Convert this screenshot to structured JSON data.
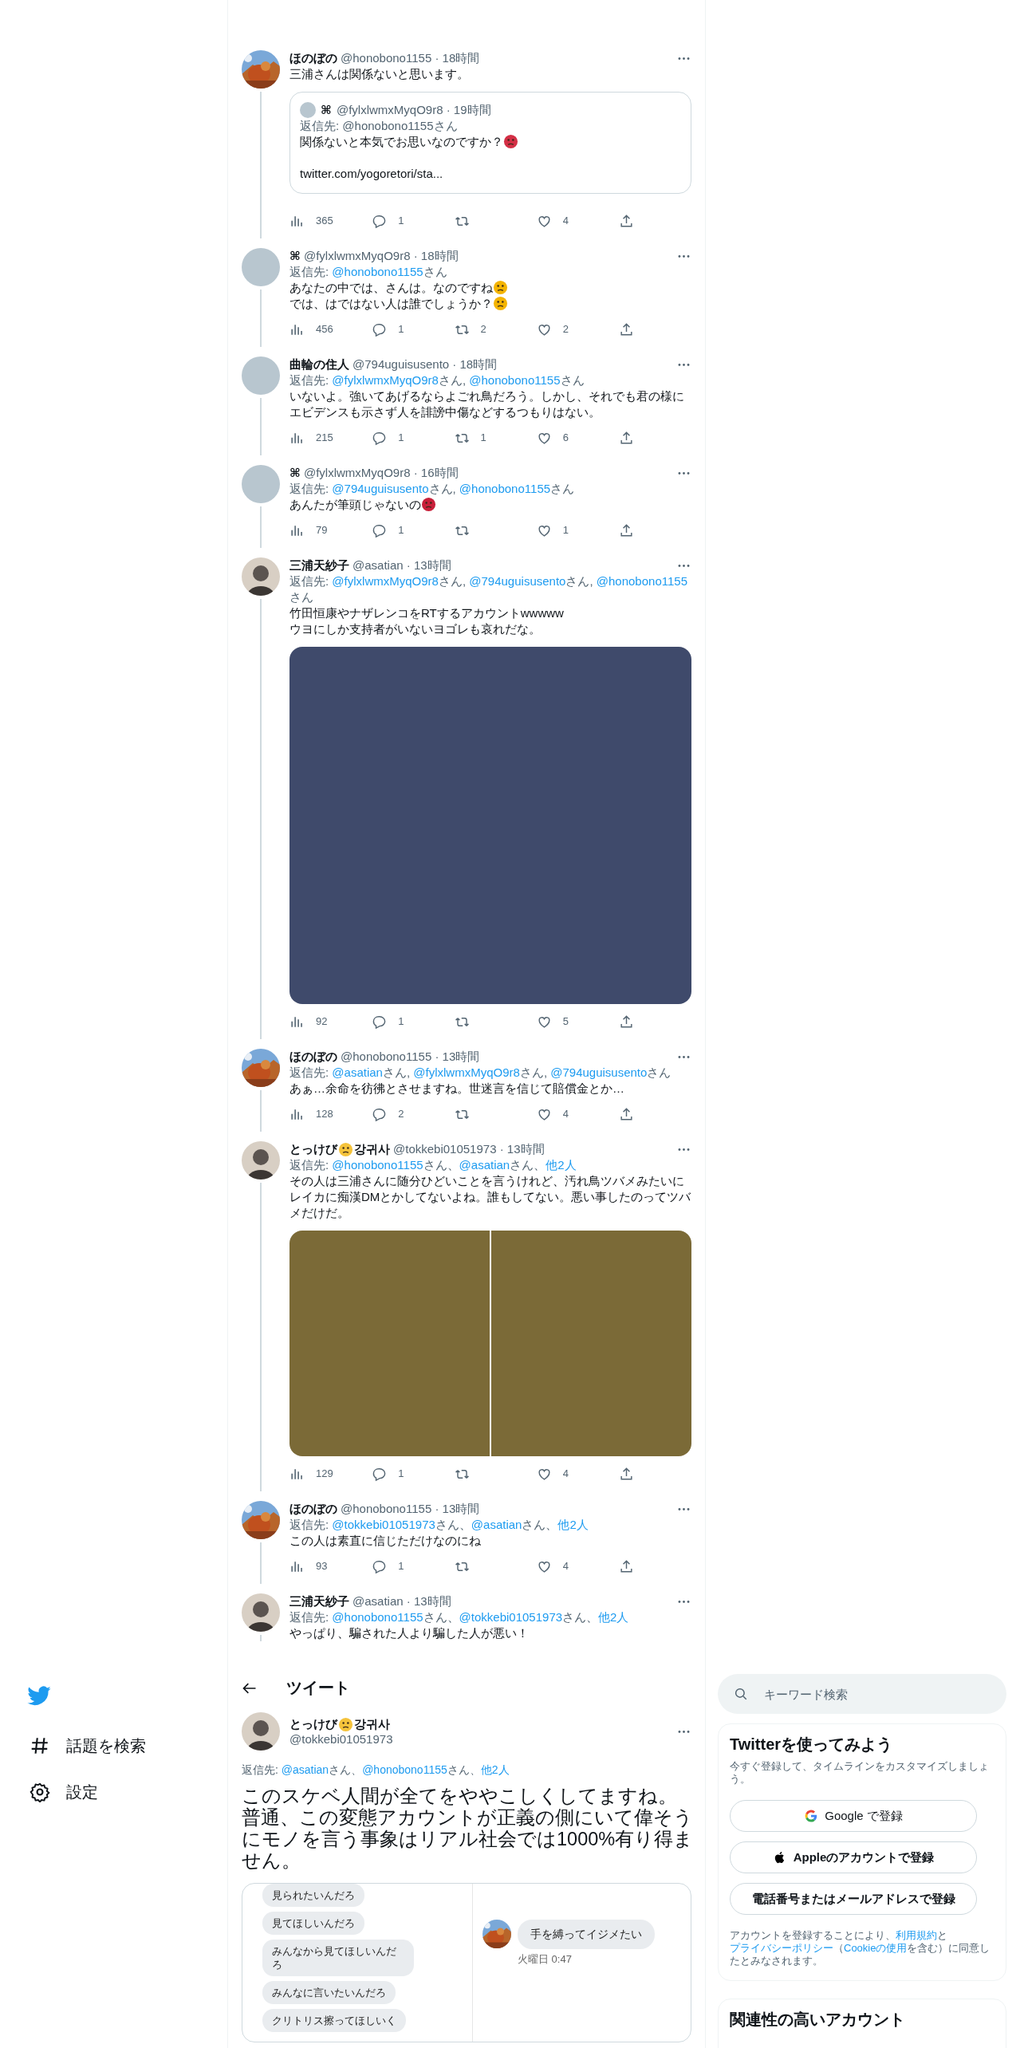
{
  "thread": [
    {
      "avatar": {
        "kind": "picture"
      },
      "name": [
        {
          "kind": "text",
          "text": "ほのぼの"
        }
      ],
      "meta": "@honobono1155 · 18時間",
      "body": [
        [
          {
            "kind": "text",
            "text": "三浦さんは関係ないと思います。"
          }
        ]
      ],
      "quote": {
        "name": "⌘",
        "meta": "@fylxlwmxMyqO9r8 · 19時間",
        "reply_to": [
          {
            "kind": "plain",
            "text": "返信先: @honobono1155さん"
          }
        ],
        "body": [
          [
            {
              "kind": "text",
              "text": "関係ないと本気でお思いなのですか？"
            },
            {
              "kind": "emoji",
              "color": "#d32f45"
            }
          ]
        ],
        "link": "twitter.com/yogoretori/sta..."
      },
      "stats": {
        "views": "365",
        "replies": "1",
        "likes": "4"
      }
    },
    {
      "avatar": {
        "kind": "blank"
      },
      "name": [
        {
          "kind": "text",
          "text": "⌘"
        }
      ],
      "meta": "@fylxlwmxMyqO9r8 · 18時間",
      "reply_to": [
        {
          "kind": "plain",
          "text": "返信先: "
        },
        {
          "kind": "mention",
          "text": "@honobono1155"
        },
        {
          "kind": "plain",
          "text": "さん"
        }
      ],
      "body": [
        [
          {
            "kind": "text",
            "text": "あなたの中では、さんは。なのですね"
          },
          {
            "kind": "emoji",
            "color": "#f4b400"
          }
        ],
        [
          {
            "kind": "text",
            "text": "では、はではない人は誰でしょうか？"
          },
          {
            "kind": "emoji",
            "color": "#f4b400"
          }
        ]
      ],
      "stats": {
        "views": "456",
        "replies": "1",
        "retweets": "2",
        "likes": "2"
      }
    },
    {
      "avatar": {
        "kind": "blank"
      },
      "name": [
        {
          "kind": "text",
          "text": "曲輪の住人"
        }
      ],
      "meta": "@794uguisusento · 18時間",
      "reply_to": [
        {
          "kind": "plain",
          "text": "返信先: "
        },
        {
          "kind": "mention",
          "text": "@fylxlwmxMyqO9r8"
        },
        {
          "kind": "plain",
          "text": "さん, "
        },
        {
          "kind": "mention",
          "text": "@honobono1155"
        },
        {
          "kind": "plain",
          "text": "さん"
        }
      ],
      "body": [
        [
          {
            "kind": "text",
            "text": "いないよ。強いてあげるならよごれ鳥だろう。しかし、それでも君の様にエビデンスも示さず人を誹謗中傷などするつもりはない。"
          }
        ]
      ],
      "stats": {
        "views": "215",
        "replies": "1",
        "retweets": "1",
        "likes": "6"
      }
    },
    {
      "avatar": {
        "kind": "blank"
      },
      "name": [
        {
          "kind": "text",
          "text": "⌘"
        }
      ],
      "meta": "@fylxlwmxMyqO9r8 · 16時間",
      "reply_to": [
        {
          "kind": "plain",
          "text": "返信先: "
        },
        {
          "kind": "mention",
          "text": "@794uguisusento"
        },
        {
          "kind": "plain",
          "text": "さん, "
        },
        {
          "kind": "mention",
          "text": "@honobono1155"
        },
        {
          "kind": "plain",
          "text": "さん"
        }
      ],
      "body": [
        [
          {
            "kind": "text",
            "text": "あんたが筆頭じゃないの"
          },
          {
            "kind": "emoji",
            "color": "#c8203a"
          }
        ]
      ],
      "stats": {
        "views": "79",
        "replies": "1",
        "likes": "1"
      }
    },
    {
      "avatar": {
        "kind": "person"
      },
      "name": [
        {
          "kind": "text",
          "text": "三浦天紗子"
        }
      ],
      "meta": "@asatian · 13時間",
      "reply_to": [
        {
          "kind": "plain",
          "text": "返信先: "
        },
        {
          "kind": "mention",
          "text": "@fylxlwmxMyqO9r8"
        },
        {
          "kind": "plain",
          "text": "さん, "
        },
        {
          "kind": "mention",
          "text": "@794uguisusento"
        },
        {
          "kind": "plain",
          "text": "さん, "
        },
        {
          "kind": "mention",
          "text": "@honobono1155"
        },
        {
          "kind": "plain",
          "text": "さん"
        }
      ],
      "body": [
        [
          {
            "kind": "text",
            "text": "竹田恒康やナザレンコをRTするアカウントwwwww"
          }
        ],
        [
          {
            "kind": "text",
            "text": "ウヨにしか支持者がいないヨゴレも哀れだな。"
          }
        ]
      ],
      "media": [
        {
          "kind": "picture",
          "color": "#3f4a6b"
        }
      ],
      "stats": {
        "views": "92",
        "replies": "1",
        "likes": "5"
      }
    },
    {
      "avatar": {
        "kind": "picture"
      },
      "name": [
        {
          "kind": "text",
          "text": "ほのぼの"
        }
      ],
      "meta": "@honobono1155 · 13時間",
      "reply_to": [
        {
          "kind": "plain",
          "text": "返信先: "
        },
        {
          "kind": "mention",
          "text": "@asatian"
        },
        {
          "kind": "plain",
          "text": "さん, "
        },
        {
          "kind": "mention",
          "text": "@fylxlwmxMyqO9r8"
        },
        {
          "kind": "plain",
          "text": "さん, "
        },
        {
          "kind": "mention",
          "text": "@794uguisusento"
        },
        {
          "kind": "plain",
          "text": "さん"
        }
      ],
      "body": [
        [
          {
            "kind": "text",
            "text": "あぁ…余命を彷彿とさせますね。世迷言を信じて賠償金とか…"
          }
        ]
      ],
      "stats": {
        "views": "128",
        "replies": "2",
        "likes": "4"
      }
    },
    {
      "avatar": {
        "kind": "person"
      },
      "name": [
        {
          "kind": "text",
          "text": "とっけび"
        },
        {
          "kind": "emoji",
          "color": "#f5c33b"
        },
        {
          "kind": "text",
          "text": "강귀사"
        }
      ],
      "meta": "@tokkebi01051973 · 13時間",
      "reply_to": [
        {
          "kind": "plain",
          "text": "返信先: "
        },
        {
          "kind": "mention",
          "text": "@honobono1155"
        },
        {
          "kind": "plain",
          "text": "さん、"
        },
        {
          "kind": "mention",
          "text": "@asatian"
        },
        {
          "kind": "plain",
          "text": "さん、"
        },
        {
          "kind": "mention",
          "text": "他2人"
        }
      ],
      "body": [
        [
          {
            "kind": "text",
            "text": "その人は三浦さんに随分ひどいことを言うけれど、汚れ鳥ツバメみたいにレイカに痴漢DMとかしてないよね。誰もしてない。悪い事したのってツバメだけだ。"
          }
        ]
      ],
      "media": [
        {
          "kind": "picture",
          "color": "#7b6a37"
        },
        {
          "kind": "picture",
          "color": "#7b6a37"
        }
      ],
      "stats": {
        "views": "129",
        "replies": "1",
        "likes": "4"
      }
    },
    {
      "avatar": {
        "kind": "picture"
      },
      "name": [
        {
          "kind": "text",
          "text": "ほのぼの"
        }
      ],
      "meta": "@honobono1155 · 13時間",
      "reply_to": [
        {
          "kind": "plain",
          "text": "返信先: "
        },
        {
          "kind": "mention",
          "text": "@tokkebi01051973"
        },
        {
          "kind": "plain",
          "text": "さん、"
        },
        {
          "kind": "mention",
          "text": "@asatian"
        },
        {
          "kind": "plain",
          "text": "さん、"
        },
        {
          "kind": "mention",
          "text": "他2人"
        }
      ],
      "body": [
        [
          {
            "kind": "text",
            "text": "この人は素直に信じただけなのにね"
          }
        ]
      ],
      "stats": {
        "views": "93",
        "replies": "1",
        "likes": "4"
      }
    },
    {
      "avatar": {
        "kind": "person"
      },
      "name": [
        {
          "kind": "text",
          "text": "三浦天紗子"
        }
      ],
      "meta": "@asatian · 13時間",
      "reply_to": [
        {
          "kind": "plain",
          "text": "返信先: "
        },
        {
          "kind": "mention",
          "text": "@honobono1155"
        },
        {
          "kind": "plain",
          "text": "さん、"
        },
        {
          "kind": "mention",
          "text": "@tokkebi01051973"
        },
        {
          "kind": "plain",
          "text": "さん、"
        },
        {
          "kind": "mention",
          "text": "他2人"
        }
      ],
      "body": [
        [
          {
            "kind": "text",
            "text": "やっぱり、騙された人より騙した人が悪い！"
          }
        ]
      ]
    }
  ],
  "nav": [
    {
      "kind": "hashtag",
      "label": "話題を検索"
    },
    {
      "kind": "settings",
      "label": "設定"
    }
  ],
  "main": {
    "header": "ツイート",
    "avatar": {
      "kind": "person"
    },
    "name": [
      {
        "kind": "text",
        "text": "とっけび"
      },
      {
        "kind": "emoji",
        "color": "#f5c33b"
      },
      {
        "kind": "text",
        "text": "강귀사"
      }
    ],
    "handle": "@tokkebi01051973",
    "reply_to": [
      {
        "kind": "plain",
        "text": "返信先: "
      },
      {
        "kind": "mention",
        "text": "@asatian"
      },
      {
        "kind": "plain",
        "text": "さん、"
      },
      {
        "kind": "mention",
        "text": "@honobono1155"
      },
      {
        "kind": "plain",
        "text": "さん、"
      },
      {
        "kind": "mention",
        "text": "他2人"
      }
    ],
    "text": [
      "このスケベ人間が全てをややこしくしてますね。",
      "普通、この変態アカウントが正義の側にいて偉そうにモノを言う事象はリアル社会では1000%有り得ません。"
    ],
    "chat": {
      "left": [
        "見られたいんだろ",
        "見てほしいんだろ",
        "みんなから見てほしいんだろ",
        "みんなに言いたいんだろ",
        "クリトリス擦ってほしいく"
      ],
      "right": {
        "avatar": {
          "kind": "picture"
        },
        "message": "手を縛ってイジメたい",
        "time": "火曜日 0:47"
      }
    }
  },
  "sidebar": {
    "search": {
      "placeholder": "キーワード検索"
    },
    "signup": {
      "title": "Twitterを使ってみよう",
      "subtitle": "今すぐ登録して、タイムラインをカスタマイズしましょう。",
      "buttons": [
        {
          "kind": "google",
          "label": "Google で登録"
        },
        {
          "kind": "apple",
          "label": "Appleのアカウントで登録"
        },
        {
          "kind": "plain",
          "label": "電話番号またはメールアドレスで登録"
        }
      ],
      "legal": [
        {
          "kind": "plain",
          "text": "アカウントを登録することにより、"
        },
        {
          "kind": "link",
          "text": "利用規約"
        },
        {
          "kind": "plain",
          "text": "と"
        },
        {
          "kind": "link",
          "text": "プライバシーポリシー"
        },
        {
          "kind": "plain",
          "text": "（"
        },
        {
          "kind": "link",
          "text": "Cookieの使用"
        },
        {
          "kind": "plain",
          "text": "を含む）に同意したとみなされます。"
        }
      ]
    },
    "related": {
      "title": "関連性の高いアカウント"
    }
  }
}
